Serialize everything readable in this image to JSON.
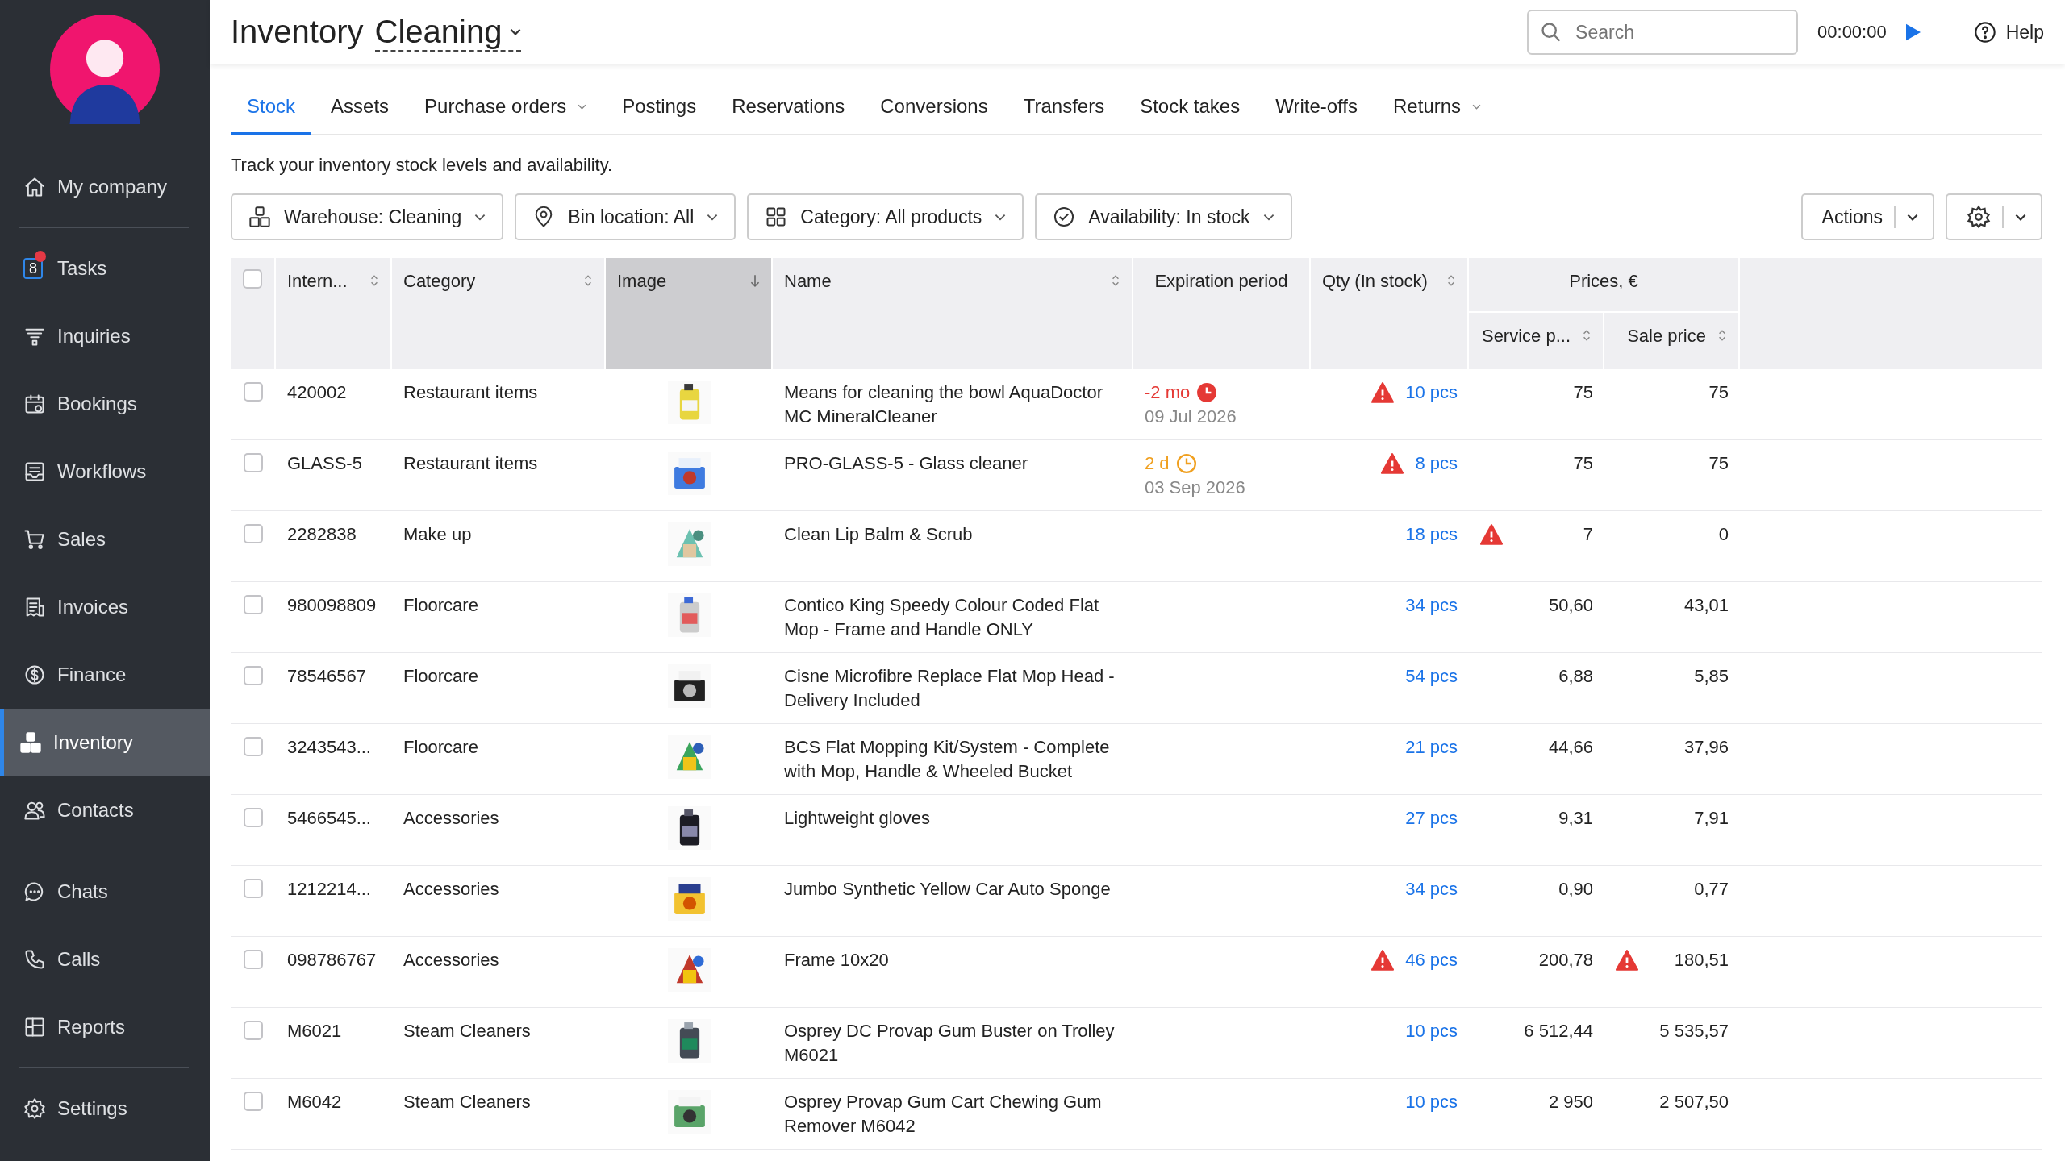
{
  "sidebar": {
    "groups": [
      [
        {
          "label": "My company",
          "selected": false
        }
      ],
      [
        {
          "label": "Tasks",
          "selected": false,
          "badge": "8",
          "unread": true
        },
        {
          "label": "Inquiries",
          "selected": false
        },
        {
          "label": "Bookings",
          "selected": false
        },
        {
          "label": "Workflows",
          "selected": false
        },
        {
          "label": "Sales",
          "selected": false
        },
        {
          "label": "Invoices",
          "selected": false
        },
        {
          "label": "Finance",
          "selected": false
        },
        {
          "label": "Inventory",
          "selected": true
        },
        {
          "label": "Contacts",
          "selected": false
        }
      ],
      [
        {
          "label": "Chats",
          "selected": false
        },
        {
          "label": "Calls",
          "selected": false
        },
        {
          "label": "Reports",
          "selected": false
        }
      ],
      [
        {
          "label": "Settings",
          "selected": false
        }
      ]
    ]
  },
  "header": {
    "title": "Inventory",
    "warehouse": "Cleaning",
    "search": {
      "placeholder": "Search"
    },
    "timer": "00:00:00",
    "help": "Help"
  },
  "tabs": [
    {
      "label": "Stock",
      "selected": true,
      "has_menu": false
    },
    {
      "label": "Assets",
      "selected": false,
      "has_menu": false
    },
    {
      "label": "Purchase orders",
      "selected": false,
      "has_menu": true
    },
    {
      "label": "Postings",
      "selected": false,
      "has_menu": false
    },
    {
      "label": "Reservations",
      "selected": false,
      "has_menu": false
    },
    {
      "label": "Conversions",
      "selected": false,
      "has_menu": false
    },
    {
      "label": "Transfers",
      "selected": false,
      "has_menu": false
    },
    {
      "label": "Stock takes",
      "selected": false,
      "has_menu": false
    },
    {
      "label": "Write-offs",
      "selected": false,
      "has_menu": false
    },
    {
      "label": "Returns",
      "selected": false,
      "has_menu": true
    }
  ],
  "description": "Track your inventory stock levels and availability.",
  "filters": [
    "Warehouse: Cleaning",
    "Bin location: All",
    "Category: All products",
    "Availability: In stock"
  ],
  "actions": {
    "label": "Actions"
  },
  "table": {
    "all_selected": false,
    "columns": [
      {
        "label": "Intern...",
        "sortable": true,
        "sorted": false
      },
      {
        "label": "Category",
        "sortable": true,
        "sorted": false
      },
      {
        "label": "Image",
        "sortable": true,
        "sorted": true
      },
      {
        "label": "Name",
        "sortable": true,
        "sorted": false
      },
      {
        "label": "Expiration period",
        "sortable": false,
        "sorted": false
      },
      {
        "label": "Qty (In stock)",
        "sortable": true,
        "sorted": false
      }
    ],
    "price_group": "Prices, €",
    "price_columns": [
      {
        "label": "Service p...",
        "sortable": true,
        "sorted": false
      },
      {
        "label": "Sale price",
        "sortable": true,
        "sorted": false
      }
    ],
    "rows": [
      {
        "selected": false,
        "id": "420002",
        "category": "Restaurant items",
        "name": "Means for cleaning the bowl AquaDoctor MC MineralCleaner",
        "expiration": {
          "kind": "overdue",
          "period": "-2 mo",
          "date": "09 Jul 2026"
        },
        "qty": "10 pcs",
        "qty_warning": true,
        "service": "75",
        "service_warning": false,
        "sale": "75",
        "sale_warning": false
      },
      {
        "selected": false,
        "id": "GLASS-5",
        "category": "Restaurant items",
        "name": "PRO-GLASS-5 - Glass cleaner",
        "expiration": {
          "kind": "soon",
          "period": "2 d",
          "date": "03 Sep 2026"
        },
        "qty": "8 pcs",
        "qty_warning": true,
        "service": "75",
        "service_warning": false,
        "sale": "75",
        "sale_warning": false
      },
      {
        "selected": false,
        "id": "2282838",
        "category": "Make up",
        "name": "Clean Lip Balm & Scrub",
        "qty": "18 pcs",
        "qty_warning": false,
        "service": "7",
        "service_warning": true,
        "sale": "0",
        "sale_warning": false
      },
      {
        "selected": false,
        "id": "980098809",
        "category": "Floorcare",
        "name": "Contico King Speedy Colour Coded Flat Mop - Frame and Handle ONLY",
        "qty": "34 pcs",
        "qty_warning": false,
        "service": "50,60",
        "service_warning": false,
        "sale": "43,01",
        "sale_warning": false
      },
      {
        "selected": false,
        "id": "78546567",
        "category": "Floorcare",
        "name": "Cisne Microfibre Replace Flat Mop Head - Delivery Included",
        "qty": "54 pcs",
        "qty_warning": false,
        "service": "6,88",
        "service_warning": false,
        "sale": "5,85",
        "sale_warning": false
      },
      {
        "selected": false,
        "id": "3243543...",
        "category": "Floorcare",
        "name": "BCS Flat Mopping Kit/System - Complete with Mop, Handle & Wheeled Bucket",
        "qty": "21 pcs",
        "qty_warning": false,
        "service": "44,66",
        "service_warning": false,
        "sale": "37,96",
        "sale_warning": false
      },
      {
        "selected": false,
        "id": "5466545...",
        "category": "Accessories",
        "name": "Lightweight gloves",
        "qty": "27 pcs",
        "qty_warning": false,
        "service": "9,31",
        "service_warning": false,
        "sale": "7,91",
        "sale_warning": false
      },
      {
        "selected": false,
        "id": "1212214...",
        "category": "Accessories",
        "name": "Jumbo Synthetic Yellow Car Auto Sponge",
        "qty": "34 pcs",
        "qty_warning": false,
        "service": "0,90",
        "service_warning": false,
        "sale": "0,77",
        "sale_warning": false
      },
      {
        "selected": false,
        "id": "098786767",
        "category": "Accessories",
        "name": "Frame 10x20",
        "qty": "46 pcs",
        "qty_warning": true,
        "service": "200,78",
        "service_warning": false,
        "sale": "180,51",
        "sale_warning": true
      },
      {
        "selected": false,
        "id": "M6021",
        "category": "Steam Cleaners",
        "name": "Osprey DC Provap Gum Buster on Trolley M6021",
        "qty": "10 pcs",
        "qty_warning": false,
        "service": "6 512,44",
        "service_warning": false,
        "sale": "5 535,57",
        "sale_warning": false
      },
      {
        "selected": false,
        "id": "M6042",
        "category": "Steam Cleaners",
        "name": "Osprey Provap Gum Cart Chewing Gum Remover M6042",
        "qty": "10 pcs",
        "qty_warning": false,
        "service": "2 950",
        "service_warning": false,
        "sale": "2 507,50",
        "sale_warning": false
      }
    ]
  }
}
